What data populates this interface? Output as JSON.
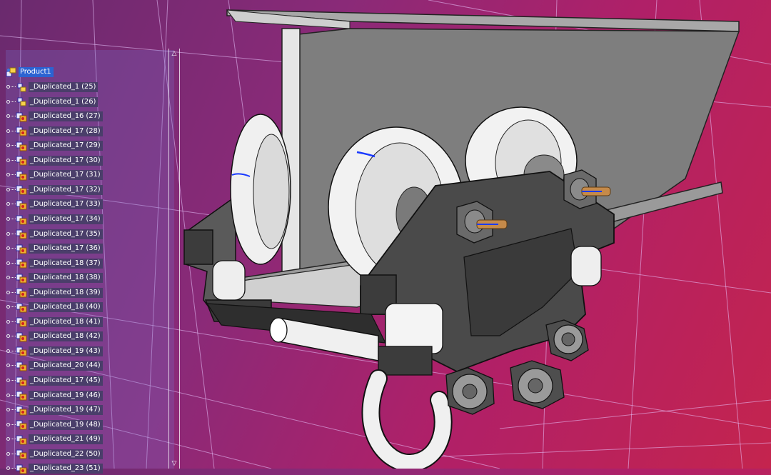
{
  "tree": {
    "root_label": "Product1",
    "items": [
      {
        "label": "_Duplicated_1 (25)",
        "kind": "product"
      },
      {
        "label": "_Duplicated_1 (26)",
        "kind": "product"
      },
      {
        "label": "_Duplicated_16 (27)",
        "kind": "part"
      },
      {
        "label": "_Duplicated_17 (28)",
        "kind": "part"
      },
      {
        "label": "_Duplicated_17 (29)",
        "kind": "part"
      },
      {
        "label": "_Duplicated_17 (30)",
        "kind": "part"
      },
      {
        "label": "_Duplicated_17 (31)",
        "kind": "part"
      },
      {
        "label": "_Duplicated_17 (32)",
        "kind": "part"
      },
      {
        "label": "_Duplicated_17 (33)",
        "kind": "part"
      },
      {
        "label": "_Duplicated_17 (34)",
        "kind": "part"
      },
      {
        "label": "_Duplicated_17 (35)",
        "kind": "part"
      },
      {
        "label": "_Duplicated_17 (36)",
        "kind": "part"
      },
      {
        "label": "_Duplicated_18 (37)",
        "kind": "part"
      },
      {
        "label": "_Duplicated_18 (38)",
        "kind": "part"
      },
      {
        "label": "_Duplicated_18 (39)",
        "kind": "part"
      },
      {
        "label": "_Duplicated_18 (40)",
        "kind": "part"
      },
      {
        "label": "_Duplicated_18 (41)",
        "kind": "part"
      },
      {
        "label": "_Duplicated_18 (42)",
        "kind": "part"
      },
      {
        "label": "_Duplicated_19 (43)",
        "kind": "part"
      },
      {
        "label": "_Duplicated_20 (44)",
        "kind": "part"
      },
      {
        "label": "_Duplicated_17 (45)",
        "kind": "part"
      },
      {
        "label": "_Duplicated_19 (46)",
        "kind": "part"
      },
      {
        "label": "_Duplicated_19 (47)",
        "kind": "part"
      },
      {
        "label": "_Duplicated_19 (48)",
        "kind": "part"
      },
      {
        "label": "_Duplicated_21 (49)",
        "kind": "part"
      },
      {
        "label": "_Duplicated_22 (50)",
        "kind": "part"
      },
      {
        "label": "_Duplicated_23 (51)",
        "kind": "part"
      }
    ]
  },
  "icons": {
    "root": "product-icon",
    "product": "product-icon",
    "part": "part-icon",
    "scroll_up": "scroll-up-arrow-icon",
    "scroll_down": "scroll-down-arrow-icon"
  },
  "colors": {
    "background_left": "#6a2a6e",
    "background_right": "#c4244e",
    "grid": "#e9c6ff",
    "selection": "#2c63d2",
    "label_bg": "#4a3e6a",
    "model_steel": "#8a8a8a",
    "model_dark": "#3a3a3a",
    "model_white": "#f2f2f2",
    "model_bronze": "#c58a4a"
  }
}
